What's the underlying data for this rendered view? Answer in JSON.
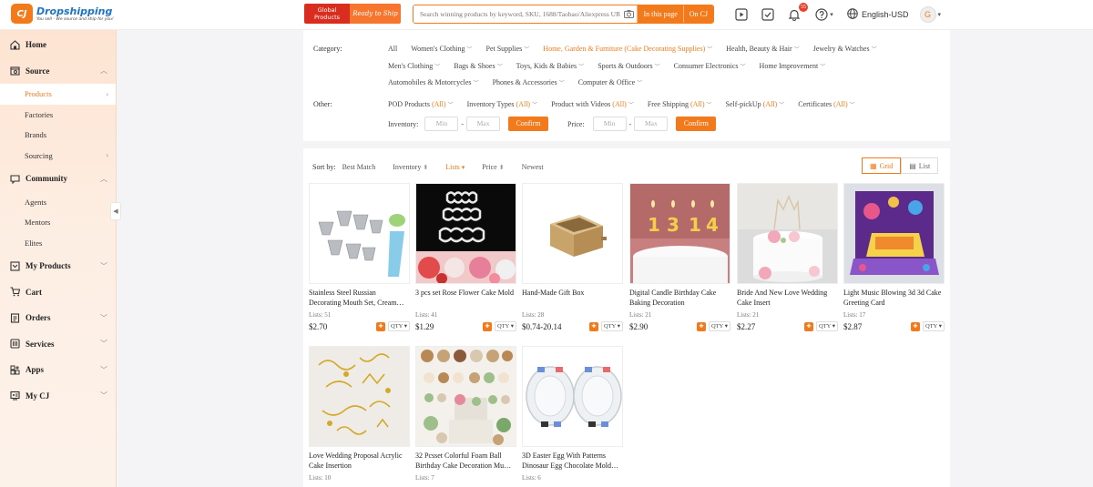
{
  "header": {
    "logo_title": "Dropshipping",
    "logo_tagline": "You sell - We source and ship for you!",
    "promo_global": "Global Products",
    "promo_ready": "Ready to Ship",
    "search_placeholder": "Search winning products by keyword, SKU, 1688/Taobao/Aliexpress URL",
    "search_in_page": "In this page",
    "search_on_cj": "On CJ",
    "notification_count": "55",
    "language": "English-USD",
    "avatar_letter": "G"
  },
  "sidebar": {
    "items": [
      {
        "label": "Home",
        "icon": "home-icon"
      },
      {
        "label": "Source",
        "icon": "source-icon"
      },
      {
        "label": "Products"
      },
      {
        "label": "Factories"
      },
      {
        "label": "Brands"
      },
      {
        "label": "Sourcing"
      },
      {
        "label": "Community",
        "icon": "community-icon"
      },
      {
        "label": "Agents"
      },
      {
        "label": "Mentors"
      },
      {
        "label": "Elites"
      },
      {
        "label": "My Products",
        "icon": "my-products-icon"
      },
      {
        "label": "Cart",
        "icon": "cart-icon"
      },
      {
        "label": "Orders",
        "icon": "orders-icon"
      },
      {
        "label": "Services",
        "icon": "services-icon"
      },
      {
        "label": "Apps",
        "icon": "apps-icon"
      },
      {
        "label": "My CJ",
        "icon": "my-cj-icon"
      }
    ]
  },
  "filters": {
    "category_label": "Category:",
    "categories": [
      "All",
      "Women's Clothing",
      "Pet Supplies",
      "Home, Garden & Furniture (Cake Decorating Supplies)",
      "Health, Beauty & Hair",
      "Jewelry & Watches",
      "Men's Clothing",
      "Bags & Shoes",
      "Toys, Kids & Babies",
      "Sports & Outdoors",
      "Consumer Electronics",
      "Home Improvement",
      "Automobiles & Motorcycles",
      "Phones & Accessories",
      "Computer & Office"
    ],
    "other_label": "Other:",
    "others": [
      {
        "name": "POD Products",
        "value": "(All)"
      },
      {
        "name": "Inventory Types",
        "value": "(All)"
      },
      {
        "name": "Product with Videos",
        "value": "(All)"
      },
      {
        "name": "Free Shipping",
        "value": "(All)"
      },
      {
        "name": "Self-pickUp",
        "value": "(All)"
      },
      {
        "name": "Certificates",
        "value": "(All)"
      }
    ],
    "inventory_label": "Inventory:",
    "price_label": "Price:",
    "min_placeholder": "Min",
    "max_placeholder": "Max",
    "dash": "-",
    "confirm": "Confirm"
  },
  "sort": {
    "label": "Sort by:",
    "options": [
      "Best Match",
      "Inventory",
      "Lists",
      "Price",
      "Newest"
    ],
    "active": "Lists",
    "view_grid": "Grid",
    "view_list": "List"
  },
  "products": [
    {
      "title": "Stainless Steel Russian Decorating Mouth Set, Cream…",
      "lists": "Lists: 51",
      "price": "$2.70"
    },
    {
      "title": "3 pcs set Rose Flower Cake Mold",
      "lists": "Lists: 41",
      "price": "$1.29"
    },
    {
      "title": "Hand-Made Gift Box",
      "lists": "Lists: 28",
      "price": "$0.74-20.14"
    },
    {
      "title": "Digital Candle Birthday Cake Baking Decoration",
      "lists": "Lists: 21",
      "price": "$2.90"
    },
    {
      "title": "Bride And New Love Wedding Cake Insert",
      "lists": "Lists: 21",
      "price": "$2.27"
    },
    {
      "title": "Light Music Blowing 3d 3d Cake Greeting Card",
      "lists": "Lists: 17",
      "price": "$2.87"
    },
    {
      "title": "Love Wedding Proposal Acrylic Cake Insertion",
      "lists": "Lists: 10",
      "price": ""
    },
    {
      "title": "32 Pcsset Colorful Foam Ball Birthday Cake Decoration Mu…",
      "lists": "Lists: 7",
      "price": ""
    },
    {
      "title": "3D Easter Egg With Patterns Dinosaur Egg Chocolate Mold…",
      "lists": "Lists: 6",
      "price": ""
    }
  ],
  "qty_label": "QTY",
  "candle_digits": [
    "1",
    "3",
    "1",
    "4"
  ],
  "colors": {
    "accent": "#f27a1a",
    "brand_blue": "#1f74c3",
    "sidebar_bg": "#fde4d2"
  }
}
